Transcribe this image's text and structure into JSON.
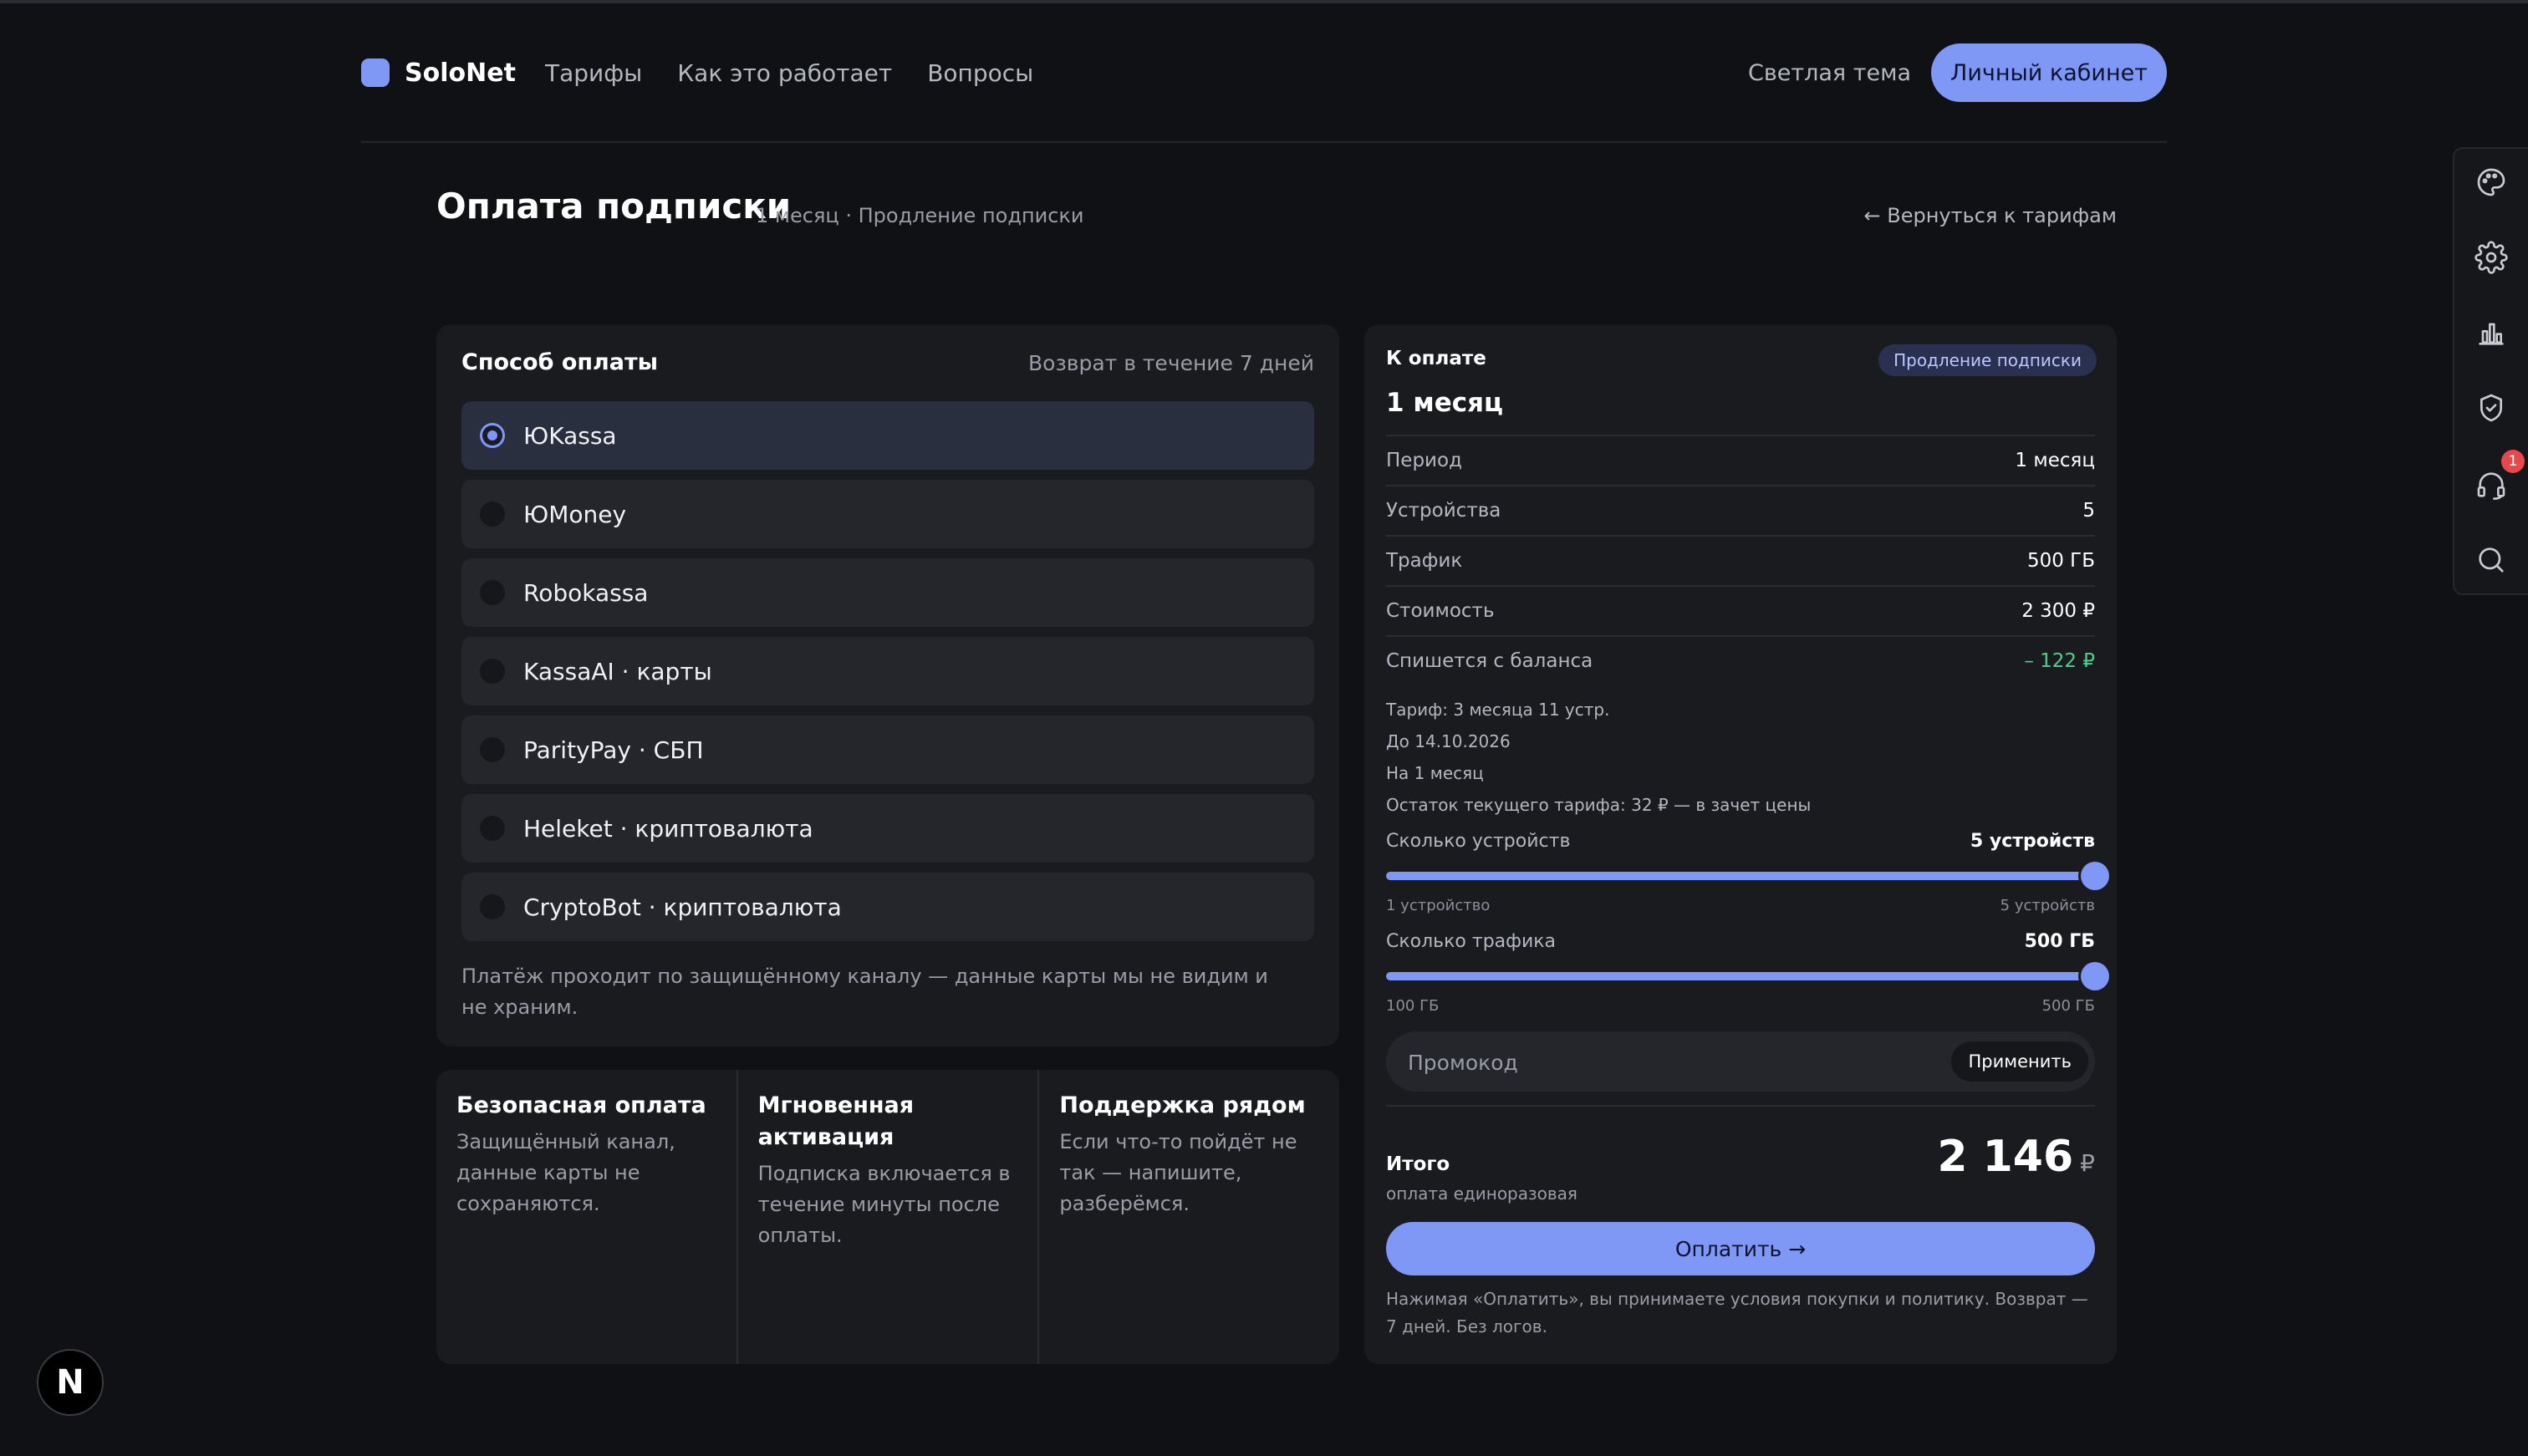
{
  "header": {
    "brand": "SoloNet",
    "nav": [
      "Тарифы",
      "Как это работает",
      "Вопросы"
    ],
    "theme_toggle": "Светлая тема",
    "cabinet_button": "Личный кабинет"
  },
  "page": {
    "title": "Оплата подписки",
    "subtitle": "1 месяц · Продление подписки",
    "back_link": "← Вернуться к тарифам"
  },
  "payment": {
    "title": "Способ оплаты",
    "refund_note": "Возврат в течение 7 дней",
    "selected": "ЮKassa",
    "methods": [
      "ЮKassa",
      "ЮMoney",
      "Robokassa",
      "KassaAI · карты",
      "ParityPay · СБП",
      "Heleket · криптовалюта",
      "CryptoBot · криптовалюта"
    ],
    "footer": "Платёж проходит по защищённому каналу — данные карты мы не видим и не храним."
  },
  "features": [
    {
      "title": "Безопасная оплата",
      "text": "Защищённый канал, данные карты не сохраняются."
    },
    {
      "title": "Мгновенная активация",
      "text": "Подписка включается в течение минуты после оплаты."
    },
    {
      "title": "Поддержка рядом",
      "text": "Если что-то пойдёт не так — напишите, разберёмся."
    }
  ],
  "summary": {
    "label": "К оплате",
    "badge": "Продление подписки",
    "plan": "1 месяц",
    "rows": [
      {
        "key": "Период",
        "value": "1 месяц"
      },
      {
        "key": "Устройства",
        "value": "5"
      },
      {
        "key": "Трафик",
        "value": "500 ГБ"
      },
      {
        "key": "Стоимость",
        "value": "2 300 ₽"
      },
      {
        "key": "Спишется с баланса",
        "value": "– 122 ₽"
      }
    ],
    "details": [
      "Тариф: 3 месяца 11 устр.",
      "До 14.10.2026",
      "На 1 месяц",
      "Остаток текущего тарифа: 32 ₽ — в зачет цены"
    ],
    "devices_slider": {
      "label": "Сколько устройств",
      "value": "5 устройств",
      "min_label": "1 устройство",
      "max_label": "5 устройств",
      "fraction": 1.0
    },
    "traffic_slider": {
      "label": "Сколько трафика",
      "value": "500 ГБ",
      "min_label": "100 ГБ",
      "max_label": "500 ГБ",
      "fraction": 1.0
    },
    "promo_placeholder": "Промокод",
    "promo_button": "Применить",
    "total_label": "Итого",
    "total_sub": "оплата единоразовая",
    "total_amount": "2 146",
    "currency": "₽",
    "pay_button": "Оплатить →",
    "legal": "Нажимая «Оплатить», вы принимаете условия покупки и политику. Возврат — 7 дней. Без логов."
  },
  "rail": {
    "icons": [
      "palette-icon",
      "gear-icon",
      "chart-icon",
      "shield-icon",
      "headset-icon",
      "search-icon"
    ],
    "support_badge": "1"
  },
  "corner_badge": "N",
  "colors": {
    "accent": "#7f97f5",
    "background": "#101114",
    "card": "#1a1b1f",
    "credit": "#4fcf8e"
  }
}
